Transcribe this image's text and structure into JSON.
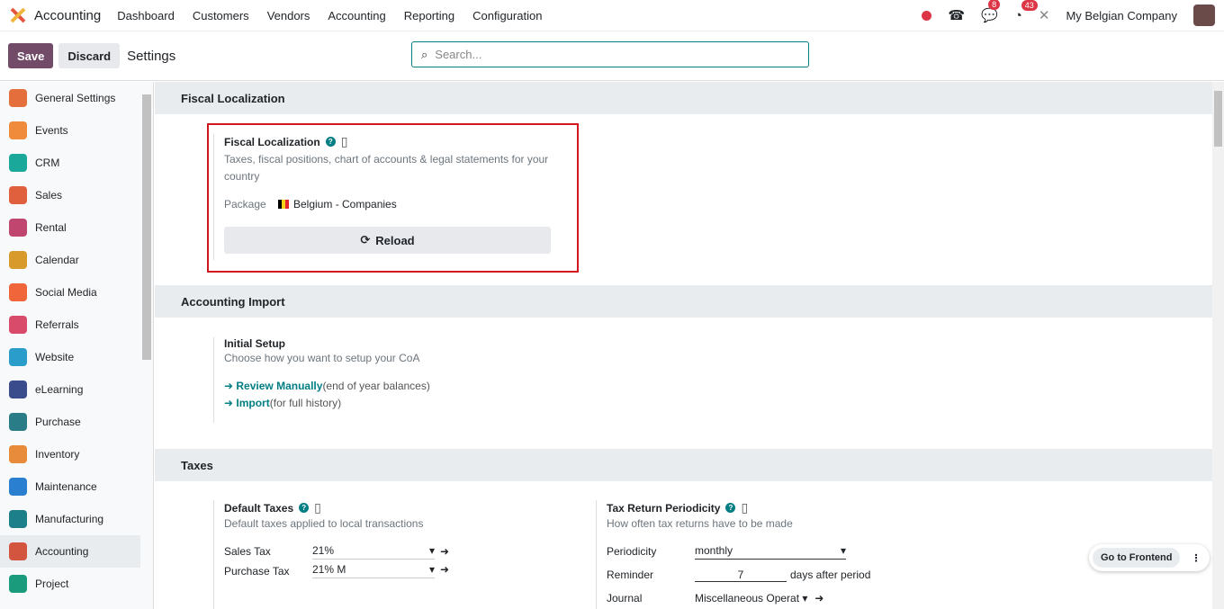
{
  "topbar": {
    "app": "Accounting",
    "menu": [
      "Dashboard",
      "Customers",
      "Vendors",
      "Accounting",
      "Reporting",
      "Configuration"
    ],
    "messages_count": "8",
    "activities_count": "43",
    "company": "My Belgian Company"
  },
  "control": {
    "save": "Save",
    "discard": "Discard",
    "title": "Settings",
    "search_placeholder": "Search..."
  },
  "sidebar": {
    "items": [
      {
        "label": "General Settings",
        "color": "#e46f3c"
      },
      {
        "label": "Events",
        "color": "#f08b3c"
      },
      {
        "label": "CRM",
        "color": "#1aa89a"
      },
      {
        "label": "Sales",
        "color": "#e0603d"
      },
      {
        "label": "Rental",
        "color": "#c0466f"
      },
      {
        "label": "Calendar",
        "color": "#d89b2b"
      },
      {
        "label": "Social Media",
        "color": "#f0663a"
      },
      {
        "label": "Referrals",
        "color": "#d84b6b"
      },
      {
        "label": "Website",
        "color": "#2b9dcb"
      },
      {
        "label": "eLearning",
        "color": "#3b4c8c"
      },
      {
        "label": "Purchase",
        "color": "#2a7c86"
      },
      {
        "label": "Inventory",
        "color": "#e88b3a"
      },
      {
        "label": "Maintenance",
        "color": "#2b7fd0"
      },
      {
        "label": "Manufacturing",
        "color": "#1d7f8a"
      },
      {
        "label": "Accounting",
        "color": "#d4553f"
      },
      {
        "label": "Project",
        "color": "#1a9b7c"
      }
    ],
    "active": "Accounting"
  },
  "fiscal": {
    "section": "Fiscal Localization",
    "title": "Fiscal Localization",
    "desc": "Taxes, fiscal positions, chart of accounts & legal statements for your country",
    "package_label": "Package",
    "package": "Belgium - Companies",
    "reload": "Reload"
  },
  "import": {
    "section": "Accounting Import",
    "title": "Initial Setup",
    "desc": "Choose how you want to setup your CoA",
    "review": "Review Manually",
    "review_note": "(end of year balances)",
    "import": "Import",
    "import_note": "(for full history)"
  },
  "taxes": {
    "section": "Taxes",
    "default_title": "Default Taxes",
    "default_desc": "Default taxes applied to local transactions",
    "sales_label": "Sales Tax",
    "sales_value": "21%",
    "purchase_label": "Purchase Tax",
    "purchase_value": "21% M",
    "period_title": "Tax Return Periodicity",
    "period_desc": "How often tax returns have to be made",
    "periodicity_label": "Periodicity",
    "periodicity_value": "monthly",
    "reminder_label": "Reminder",
    "reminder_value": "7",
    "reminder_suffix": "days after period",
    "journal_label": "Journal",
    "journal_value": "Miscellaneous Operat"
  },
  "frontend": {
    "label": "Go to Frontend"
  }
}
